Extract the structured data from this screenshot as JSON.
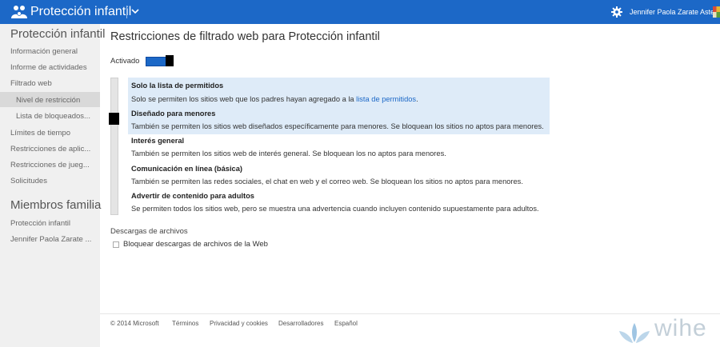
{
  "header": {
    "app_title": "Protección infantil",
    "user_name": "Jennifer Paola Zarate Astete",
    "icons": {
      "app": "family-icon",
      "menu": "chevron-down-icon",
      "settings": "gear-icon",
      "avatar": "user-avatar-icon"
    },
    "colors": {
      "bar": "#1c68c7"
    }
  },
  "sidebar": {
    "heading": "Protección infantil",
    "items": [
      "Información general",
      "Informe de actividades",
      "Filtrado web",
      "Nivel de restricción",
      "Lista de bloqueados...",
      "Límites de tiempo",
      "Restricciones de aplic...",
      "Restricciones de jueg...",
      "Solicitudes"
    ],
    "selected": "Nivel de restricción",
    "family_heading": "Miembros familia",
    "family": [
      "Protección infantil",
      "Jennifer Paola Zarate ..."
    ]
  },
  "main": {
    "title": "Restricciones de filtrado web para Protección infantil",
    "toggle": {
      "label": "Activado",
      "on": true
    },
    "selected_level": "Diseñado para menores",
    "levels": [
      {
        "title": "Solo la lista de permitidos",
        "desc_prefix": "Solo se permiten los sitios web que los padres hayan agregado a la ",
        "desc_link": "lista de permitidos",
        "desc_suffix": "."
      },
      {
        "title": "Diseñado para menores",
        "desc": "También se permiten los sitios web diseñados específicamente para menores. Se bloquean los sitios no aptos para menores."
      },
      {
        "title": "Interés general",
        "desc": "También se permiten los sitios web de interés general. Se bloquean los no aptos para menores."
      },
      {
        "title": "Comunicación en línea (básica)",
        "desc": "También se permiten las redes sociales, el chat en web y el correo web. Se bloquean los sitios no aptos para menores."
      },
      {
        "title": "Advertir de contenido para adultos",
        "desc": "Se permiten todos los sitios web, pero se muestra una advertencia cuando incluyen contenido supuestamente para adultos."
      }
    ],
    "downloads": {
      "title": "Descargas de archivos",
      "checkbox_label": "Bloquear descargas de archivos de la Web",
      "checked": false
    }
  },
  "footer": {
    "copyright": "© 2014 Microsoft",
    "links": [
      "Términos",
      "Privacidad y cookies",
      "Desarrolladores",
      "Español"
    ]
  },
  "watermark": {
    "text": "wihe"
  }
}
